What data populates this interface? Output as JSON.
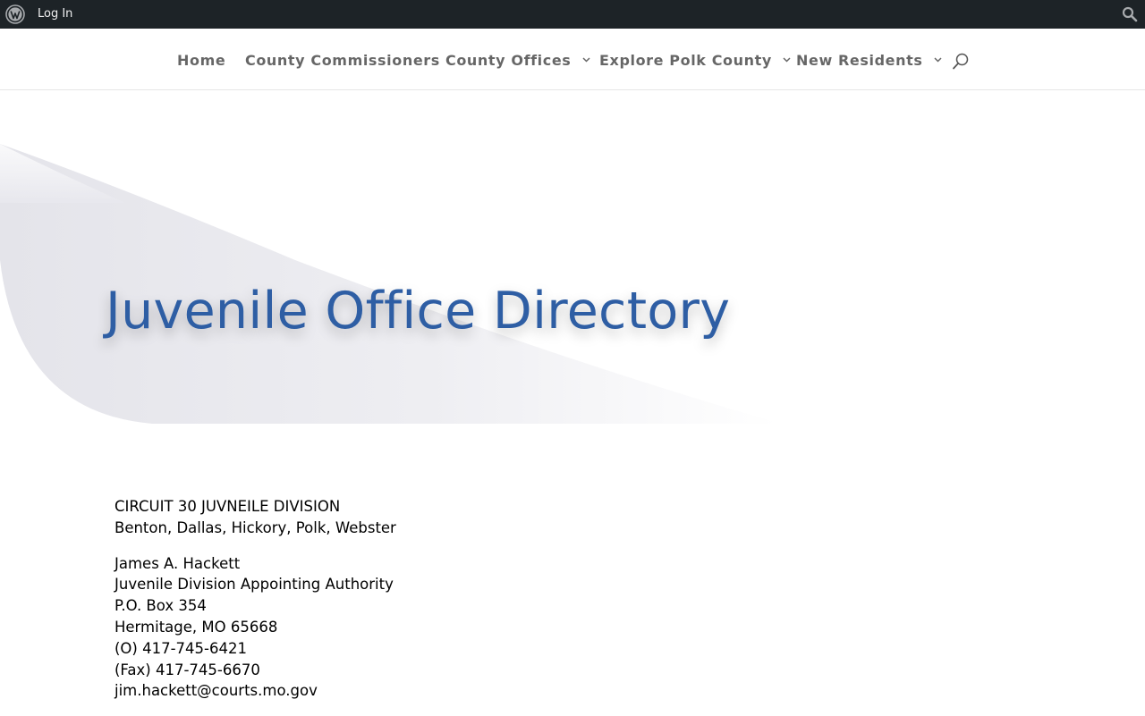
{
  "adminbar": {
    "login_label": "Log In",
    "logo_icon": "wordpress-icon",
    "search_icon": "search-icon"
  },
  "nav": {
    "items": [
      {
        "label": "Home",
        "has_dropdown": false
      },
      {
        "label": "County Commissioners",
        "has_dropdown": false
      },
      {
        "label": "County Offices",
        "has_dropdown": true
      },
      {
        "label": "Explore Polk County",
        "has_dropdown": true
      },
      {
        "label": "New Residents",
        "has_dropdown": true
      }
    ],
    "search_icon": "search-icon"
  },
  "hero": {
    "title": "Juvenile Office Directory"
  },
  "content": {
    "heading_line1": "CIRCUIT 30 JUVNEILE DIVISION",
    "heading_line2": "Benton, Dallas, Hickory, Polk, Webster",
    "contact": {
      "name": "James A. Hackett",
      "role": "Juvenile Division Appointing Authority",
      "address1": "P.O. Box 354",
      "address2": "Hermitage, MO 65668",
      "phone": "(O) 417-745-6421",
      "fax": "(Fax) 417-745-6670",
      "email": "jim.hackett@courts.mo.gov"
    }
  },
  "colors": {
    "adminbar_bg": "#1d2327",
    "title_blue": "#2e5ea4",
    "nav_text": "#666666"
  }
}
